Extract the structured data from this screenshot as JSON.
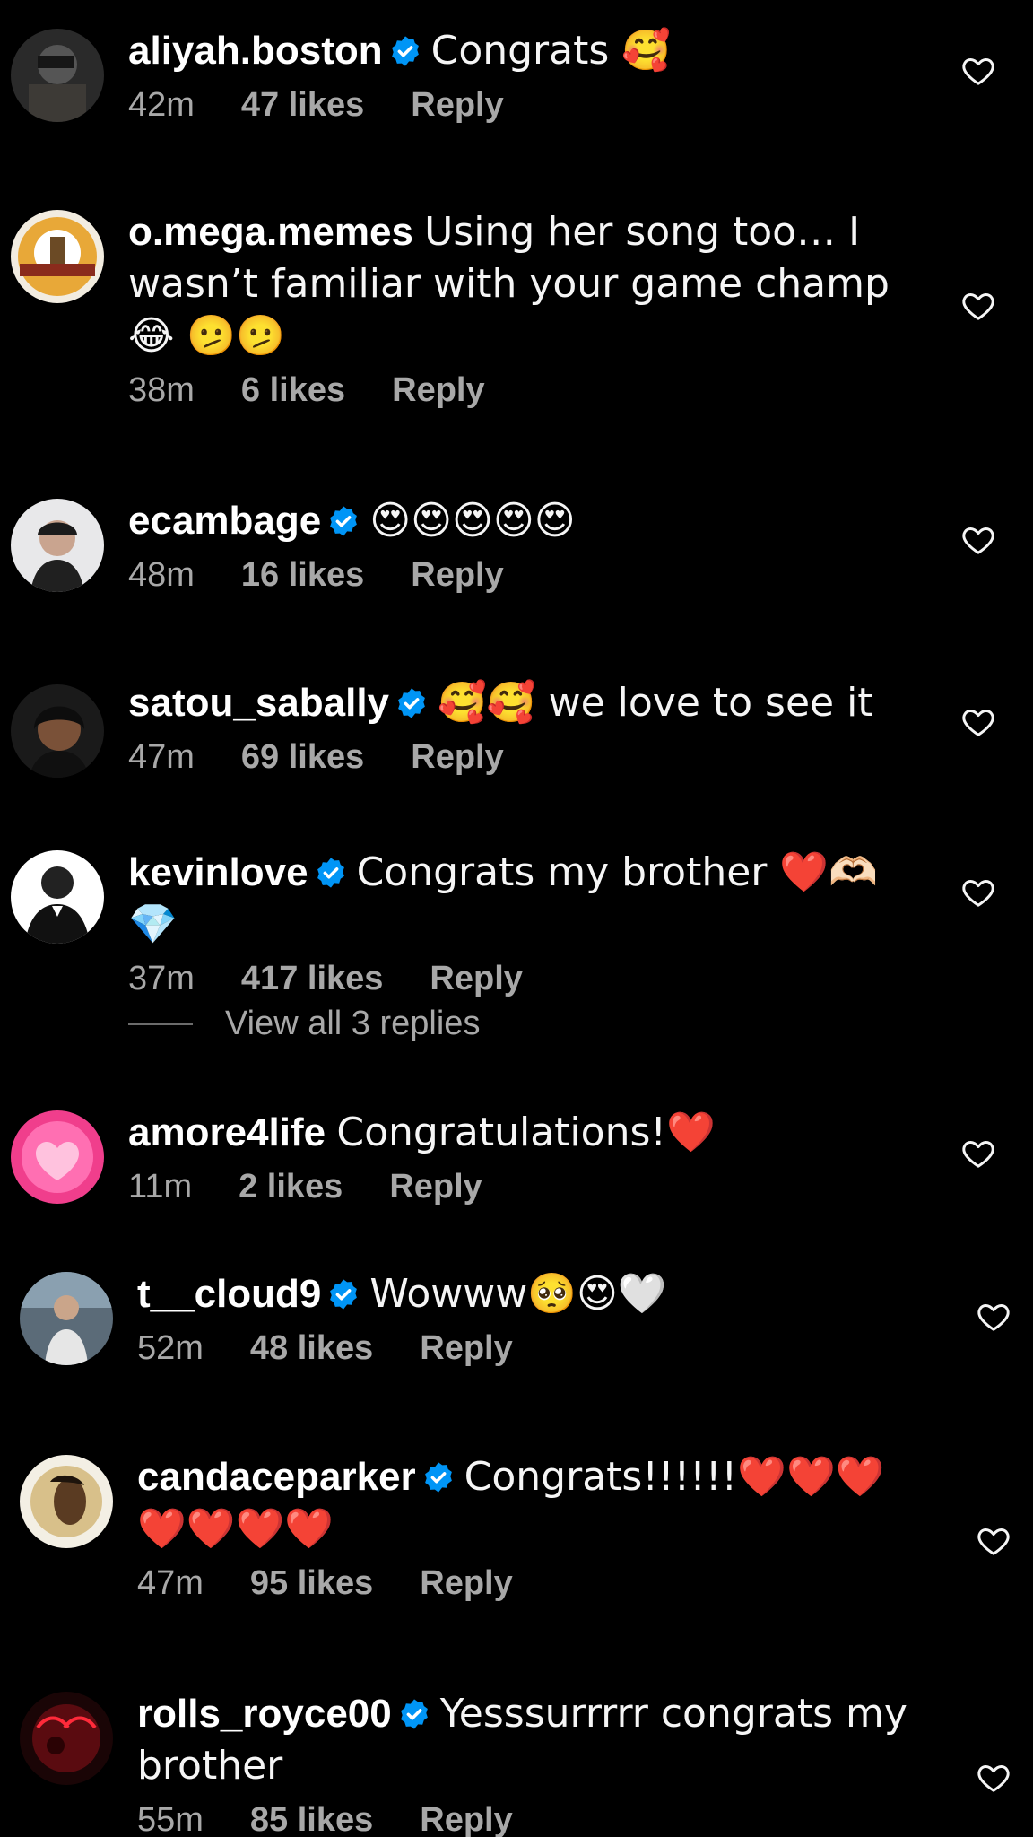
{
  "comments": [
    {
      "username": "aliyah.boston",
      "verified": true,
      "text": "Congrats 🥰",
      "time": "42m",
      "likes": "47 likes",
      "reply": "Reply"
    },
    {
      "username": "o.mega.memes",
      "verified": false,
      "text": "Using her song too… I wasn’t familiar with your game champ 😂 🫤🫤",
      "time": "38m",
      "likes": "6 likes",
      "reply": "Reply"
    },
    {
      "username": "ecambage",
      "verified": true,
      "text": "😍😍😍😍😍",
      "time": "48m",
      "likes": "16 likes",
      "reply": "Reply"
    },
    {
      "username": "satou_sabally",
      "verified": true,
      "text": "🥰🥰 we love to see it",
      "time": "47m",
      "likes": "69 likes",
      "reply": "Reply"
    },
    {
      "username": "kevinlove",
      "verified": true,
      "text": "Congrats my brother ❤️🫶🏻💎",
      "time": "37m",
      "likes": "417 likes",
      "reply": "Reply"
    },
    {
      "username": "amore4life",
      "verified": false,
      "text": "Congratulations!❤️",
      "time": "11m",
      "likes": "2 likes",
      "reply": "Reply"
    },
    {
      "username": "t__cloud9",
      "verified": true,
      "text": "Wowww🥺😍🤍",
      "time": "52m",
      "likes": "48 likes",
      "reply": "Reply"
    },
    {
      "username": "candaceparker",
      "verified": true,
      "text": "Congrats!!!!!!❤️❤️❤️❤️❤️❤️❤️",
      "time": "47m",
      "likes": "95 likes",
      "reply": "Reply"
    },
    {
      "username": "rolls_royce00",
      "verified": true,
      "text": "Yesssurrrrr congrats my brother",
      "time": "55m",
      "likes": "85 likes",
      "reply": "Reply"
    }
  ],
  "view_replies": "View all 3 replies",
  "colors": {
    "background": "#000000",
    "verified": "#0095f6",
    "meta": "#a8a8a8"
  },
  "icons": {
    "like": "heart-outline-icon",
    "verified": "verified-badge-icon"
  }
}
